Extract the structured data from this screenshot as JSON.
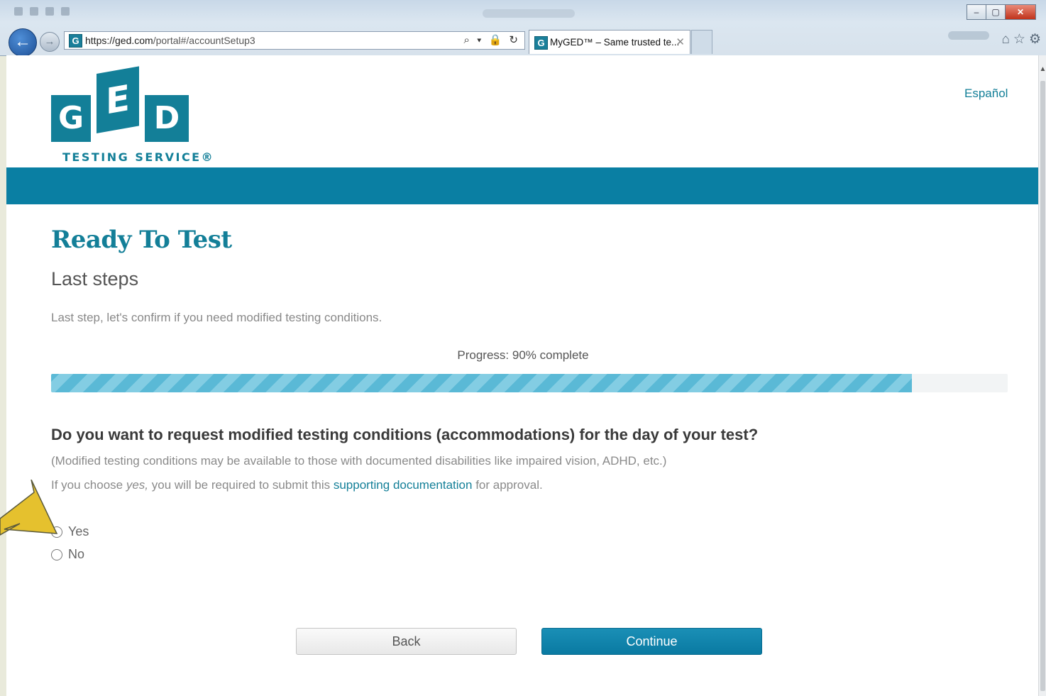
{
  "browser": {
    "url_host": "https://ged.com",
    "url_path": "/portal#/accountSetup3",
    "address_tools": "⌕ ▾ 🔒 ↻",
    "tab_title": "MyGED™ – Same trusted te...",
    "tab_close": "✕",
    "favicon_letter": "G",
    "window_controls": {
      "minimize": "–",
      "maximize": "▢",
      "close": "✕"
    },
    "back_glyph": "←",
    "forward_glyph": "→",
    "toolbar_icons": "⌂☆⚙"
  },
  "header": {
    "logo_letters": {
      "g": "G",
      "e": "E",
      "d": "D"
    },
    "logo_text": "TESTING SERVICE®",
    "language_link": "Español",
    "brand_color": "#0a7fa3"
  },
  "main": {
    "title": "Ready To Test",
    "subtitle": "Last steps",
    "intro": "Last step, let's confirm if you need modified testing conditions.",
    "progress": {
      "label": "Progress: 90% complete",
      "percent": 90
    },
    "question": "Do you want to request modified testing conditions (accommodations) for the day of your test?",
    "note1": "(Modified testing conditions may be available to those with documented disabilities like impaired vision, ADHD, etc.)",
    "note2_prefix": "If you choose ",
    "note2_em": "yes,",
    "note2_middle": " you will be required to submit this ",
    "note2_link": "supporting documentation",
    "note2_suffix": " for approval.",
    "options": [
      {
        "label": "Yes",
        "selected": false
      },
      {
        "label": "No",
        "selected": false
      }
    ],
    "buttons": {
      "back": "Back",
      "continue": "Continue"
    }
  },
  "annotation": {
    "type": "arrow-icon",
    "color": "#e5c12e"
  }
}
